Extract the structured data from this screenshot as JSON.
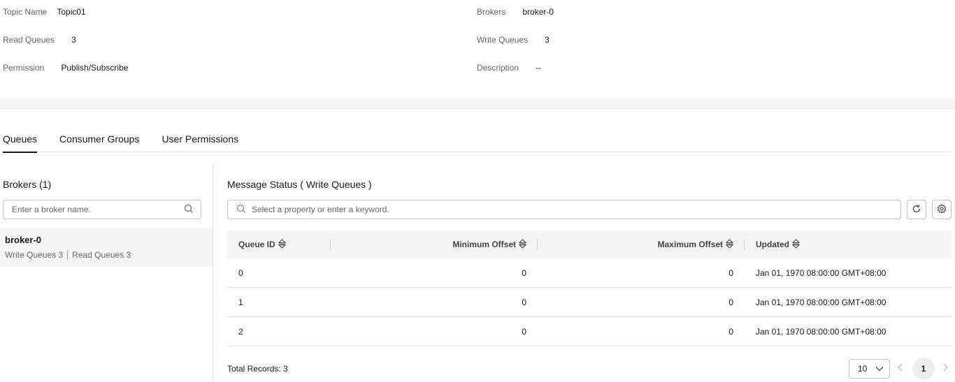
{
  "topic_info": {
    "topic_name_label": "Topic Name",
    "topic_name_value": "Topic01",
    "brokers_label": "Brokers",
    "brokers_value": "broker-0",
    "read_queues_label": "Read Queues",
    "read_queues_value": "3",
    "write_queues_label": "Write Queues",
    "write_queues_value": "3",
    "permission_label": "Permission",
    "permission_value": "Publish/Subscribe",
    "description_label": "Description",
    "description_value": "--"
  },
  "tabs": [
    {
      "label": "Queues",
      "active": true
    },
    {
      "label": "Consumer Groups",
      "active": false
    },
    {
      "label": "User Permissions",
      "active": false
    }
  ],
  "brokers_panel": {
    "title": "Brokers (1)",
    "search_placeholder": "Enter a broker name.",
    "items": [
      {
        "name": "broker-0",
        "write_queues": "Write Queues 3",
        "read_queues": "Read Queues 3"
      }
    ]
  },
  "message_status": {
    "title": "Message Status ( Write Queues )",
    "search_placeholder": "Select a property or enter a keyword.",
    "columns": [
      "Queue ID",
      "Minimum Offset",
      "Maximum Offset",
      "Updated"
    ],
    "rows": [
      {
        "queue_id": "0",
        "min_offset": "0",
        "max_offset": "0",
        "updated": "Jan 01, 1970 08:00:00 GMT+08:00"
      },
      {
        "queue_id": "1",
        "min_offset": "0",
        "max_offset": "0",
        "updated": "Jan 01, 1970 08:00:00 GMT+08:00"
      },
      {
        "queue_id": "2",
        "min_offset": "0",
        "max_offset": "0",
        "updated": "Jan 01, 1970 08:00:00 GMT+08:00"
      }
    ],
    "total_records": "Total Records: 3",
    "page_size": "10",
    "current_page": "1"
  },
  "icons": {
    "search": "search-icon",
    "refresh": "refresh-icon",
    "settings": "gear-icon",
    "sort": "sort-icon",
    "chevron_down": "chevron-down-icon",
    "prev": "chevron-left-icon",
    "next": "chevron-right-icon"
  }
}
